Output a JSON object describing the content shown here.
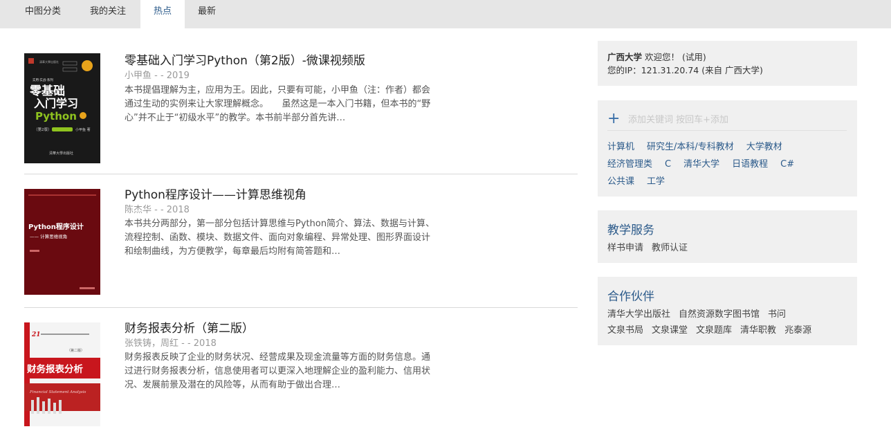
{
  "tabs": [
    "中图分类",
    "我的关注",
    "热点",
    "最新"
  ],
  "books": [
    {
      "title": "零基础入门学习Python（第2版）-微课视频版",
      "meta": "小甲鱼 - - 2019",
      "desc": "本书提倡理解为主，应用为王。因此，只要有可能，小甲鱼（注：作者）都会通过生动的实例来让大家理解概念。　　虽然这是一本入门书籍，但本书的“野心”并不止于“初级水平”的教学。本书前半部分首先讲…",
      "cover": {
        "series": "实用·实战·系列",
        "line1": "零基础",
        "line2": "入门学习",
        "line3": "Python",
        "edition": "（第2版）",
        "author": "小甲鱼 著",
        "publisher": "清華大學出版社"
      }
    },
    {
      "title": "Python程序设计——计算思维视角",
      "meta": "陈杰华 - - 2018",
      "desc": "本书共分两部分，第一部分包括计算思维与Python简介、算法、数据与计算、流程控制、函数、模块、数据文件、面向对象编程、异常处理、图形界面设计和绘制曲线，为方便教学，每章最后均附有简答题和…",
      "cover": {
        "line1": "Python程序设计",
        "line2": "—— 计算思维视角"
      }
    },
    {
      "title": "财务报表分析（第二版）",
      "meta": "张铁铸，周红 - - 2018",
      "desc": "财务报表反映了企业的财务状况、经营成果及现金流量等方面的财务信息。通过进行财务报表分析，信息使用者可以更深入地理解企业的盈利能力、信用状况、发展前景及潜在的风险等，从而有助于做出合理…",
      "cover": {
        "num": "21",
        "edition": "（第二版）",
        "line1": "财务报表分析",
        "subtitle": "Financial Statement Analysis"
      }
    }
  ],
  "user": {
    "school": "广西大学",
    "welcome": "欢迎您！ (试用)",
    "ip_line": "您的IP：121.31.20.74 (来自 广西大学)"
  },
  "tags": {
    "placeholder": "添加关键词 按回车+添加",
    "row1": [
      "计算机",
      "研究生/本科/专科教材",
      "大学教材"
    ],
    "row2": [
      "经济管理类",
      "C",
      "清华大学",
      "日语教程",
      "C#"
    ],
    "row3": [
      "公共课",
      "工学"
    ]
  },
  "service": {
    "title": "教学服务",
    "links": [
      "样书申请",
      "教师认证"
    ]
  },
  "partner": {
    "title": "合作伙伴",
    "row1": [
      "清华大学出版社",
      "自然资源数字图书馆",
      "书问"
    ],
    "row2": [
      "文泉书局",
      "文泉课堂",
      "文泉题库",
      "清华职教",
      "兆泰源"
    ]
  },
  "colors": {
    "accent": "#2b5a8a",
    "tabbar": "#e6e6e6",
    "panel": "#f0f0f0"
  }
}
